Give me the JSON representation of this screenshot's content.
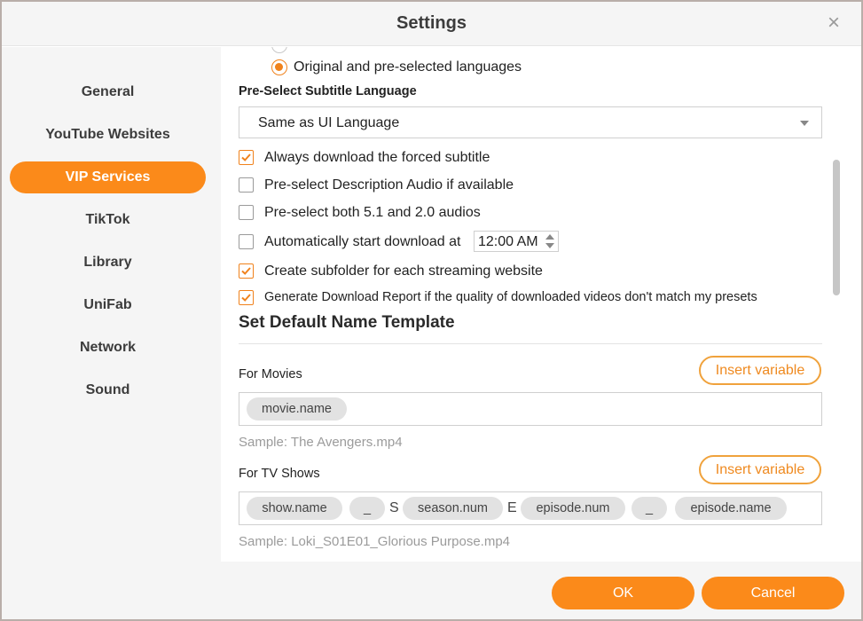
{
  "window": {
    "title": "Settings",
    "close_glyph": "×"
  },
  "sidebar": {
    "items": [
      {
        "label": "General"
      },
      {
        "label": "YouTube Websites"
      },
      {
        "label": "VIP Services",
        "active": true
      },
      {
        "label": "TikTok"
      },
      {
        "label": "Library"
      },
      {
        "label": "UniFab"
      },
      {
        "label": "Network"
      },
      {
        "label": "Sound"
      }
    ]
  },
  "content": {
    "radio_selected_label": "Original and pre-selected languages",
    "subtitle_section": {
      "heading": "Pre-Select Subtitle Language",
      "dropdown_value": "Same as UI Language"
    },
    "checkboxes": [
      {
        "label": "Always download the forced subtitle",
        "checked": true
      },
      {
        "label": "Pre-select Description Audio if available",
        "checked": false
      },
      {
        "label": "Pre-select both 5.1 and 2.0 audios",
        "checked": false
      },
      {
        "label": "Automatically start download at",
        "checked": false
      },
      {
        "label": "Create subfolder for each streaming website",
        "checked": true
      },
      {
        "label": "Generate Download Report if the quality of downloaded videos don't match my presets",
        "checked": true
      }
    ],
    "auto_start_time": "12:00 AM",
    "name_template": {
      "heading": "Set Default Name Template",
      "movies": {
        "label": "For Movies",
        "insert_label": "Insert variable",
        "tokens": [
          "movie.name"
        ],
        "sample": "Sample: The Avengers.mp4"
      },
      "tv": {
        "label": "For TV Shows",
        "insert_label": "Insert variable",
        "tokens": [
          "show.name",
          "_",
          "S",
          "season.num",
          "E",
          "episode.num",
          "_",
          "episode.name"
        ],
        "sample": "Sample: Loki_S01E01_Glorious Purpose.mp4"
      }
    }
  },
  "footer": {
    "ok_label": "OK",
    "cancel_label": "Cancel"
  },
  "colors": {
    "accent": "#fb8a1a",
    "panel": "#f5f5f5"
  }
}
